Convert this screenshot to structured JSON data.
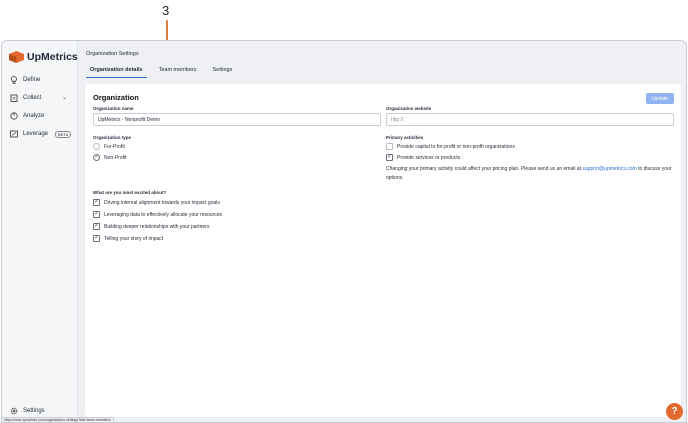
{
  "annotation": {
    "number": "3"
  },
  "app": {
    "logo_text": "UpMetrics"
  },
  "sidebar": {
    "items": [
      {
        "label": "Define"
      },
      {
        "label": "Collect"
      },
      {
        "label": "Analyze"
      },
      {
        "label": "Leverage",
        "badge": "BETA"
      }
    ],
    "settings_label": "Settings"
  },
  "header": {
    "title": "Organization Settings"
  },
  "tabs": [
    {
      "label": "Organization details"
    },
    {
      "label": "Team members"
    },
    {
      "label": "Settings"
    }
  ],
  "card": {
    "title": "Organization",
    "update_label": "Update",
    "org_name": {
      "label": "Organization name",
      "value": "UpMetrics - Nonprofit Demo"
    },
    "org_website": {
      "label": "Organization website",
      "placeholder": "http://"
    },
    "org_type": {
      "label": "Organization type",
      "options": [
        {
          "label": "For-Profit",
          "checked": false
        },
        {
          "label": "Non-Profit",
          "checked": true
        }
      ]
    },
    "primary_activities": {
      "label": "Primary activities",
      "options": [
        {
          "label": "Provide capital to for-profit or non-profit organizations",
          "checked": false
        },
        {
          "label": "Provide services or products",
          "checked": true
        }
      ],
      "note_before": "Changing your primary activity could affect your pricing plan. Please send us an email at",
      "note_email": "support@upmetrics.com",
      "note_after": "to discuss your options."
    },
    "excited": {
      "label": "What are you most excited about?",
      "options": [
        {
          "label": "Driving internal alignment towards your impact goals",
          "checked": true
        },
        {
          "label": "Leveraging data to effectively allocate your resources",
          "checked": true
        },
        {
          "label": "Building deeper relationships with your partners",
          "checked": true
        },
        {
          "label": "Telling your story of impact",
          "checked": true
        }
      ]
    }
  },
  "help": {
    "label": "?"
  },
  "statusbar": {
    "url": "https://next.upmetrics.com/organization-settings?tab=team-members"
  }
}
